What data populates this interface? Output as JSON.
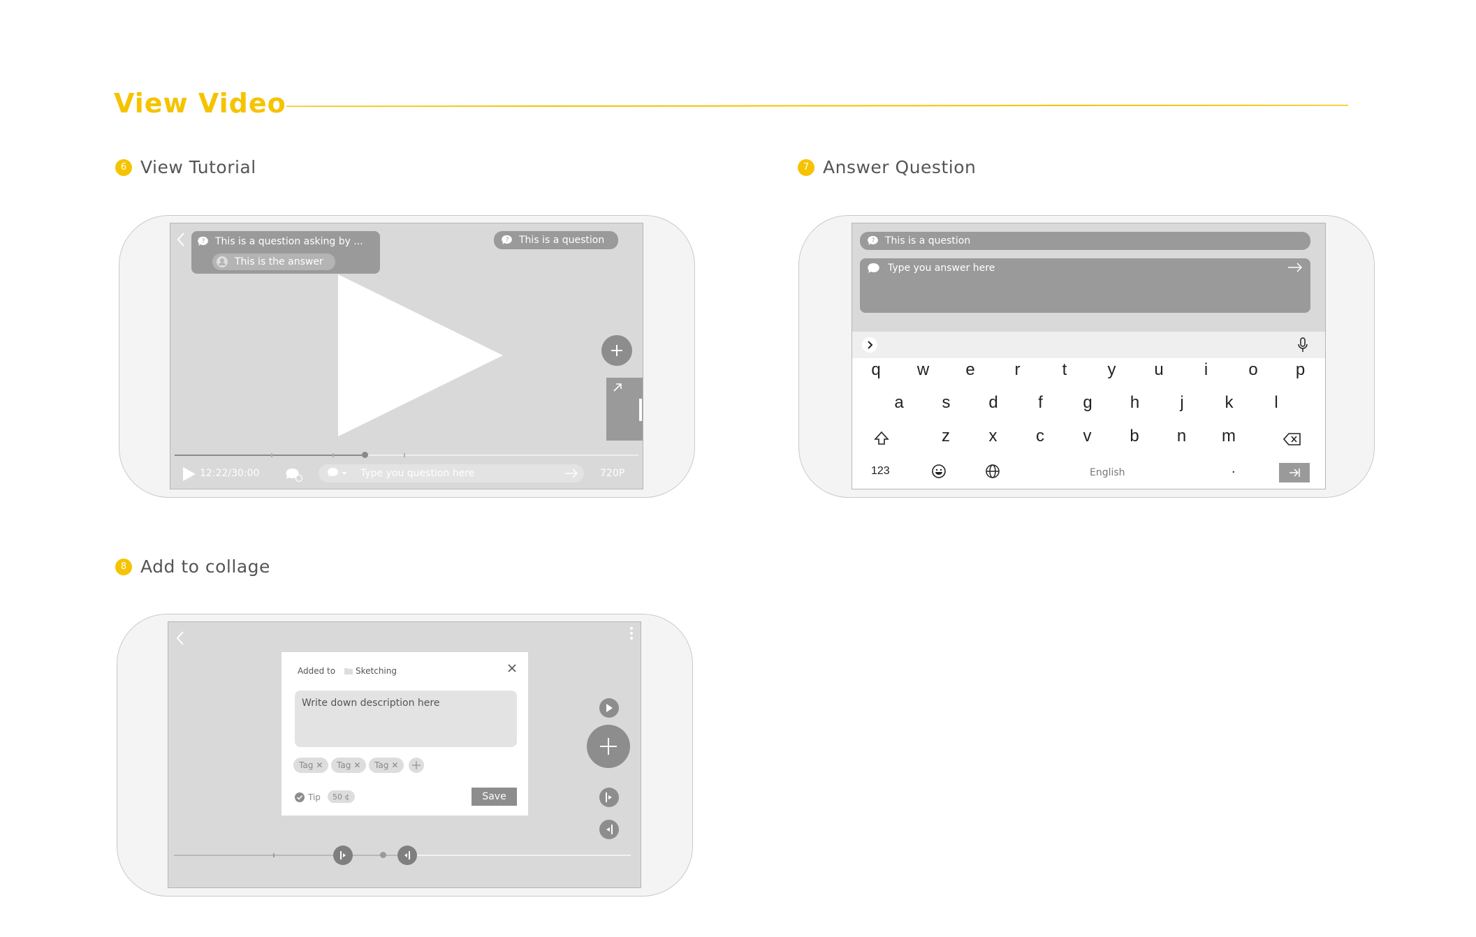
{
  "page_title": "View Video",
  "sections": [
    {
      "num": "6",
      "label": "View Tutorial"
    },
    {
      "num": "7",
      "label": "Answer Question"
    },
    {
      "num": "8",
      "label": "Add to collage"
    }
  ],
  "tutorial": {
    "question_bubble": "This is a question asking by ...",
    "answer_bubble": "This is the answer",
    "question_pill": "This is a question",
    "time": "12:22/30:00",
    "question_placeholder": "Type you question here",
    "quality": "720P",
    "progress_fraction": 0.41
  },
  "answer": {
    "question": "This is a question",
    "answer_placeholder": "Type you answer here",
    "keyboard": {
      "row1": [
        "q",
        "w",
        "e",
        "r",
        "t",
        "y",
        "u",
        "i",
        "o",
        "p"
      ],
      "row2": [
        "a",
        "s",
        "d",
        "f",
        "g",
        "h",
        "j",
        "k",
        "l"
      ],
      "row3": [
        "z",
        "x",
        "c",
        "v",
        "b",
        "n",
        "m"
      ],
      "numbers_key": "123",
      "language": "English",
      "period": "."
    }
  },
  "collage": {
    "added_to_label": "Added to",
    "folder": "Sketching",
    "description_placeholder": "Write down description here",
    "tags": [
      "Tag",
      "Tag",
      "Tag"
    ],
    "tip_label": "Tip",
    "tip_amount": "50 ¢",
    "save_label": "Save"
  },
  "colors": {
    "accent": "#f5c300",
    "pill": "#9a9a9a",
    "screen": "#d9d9d9"
  }
}
